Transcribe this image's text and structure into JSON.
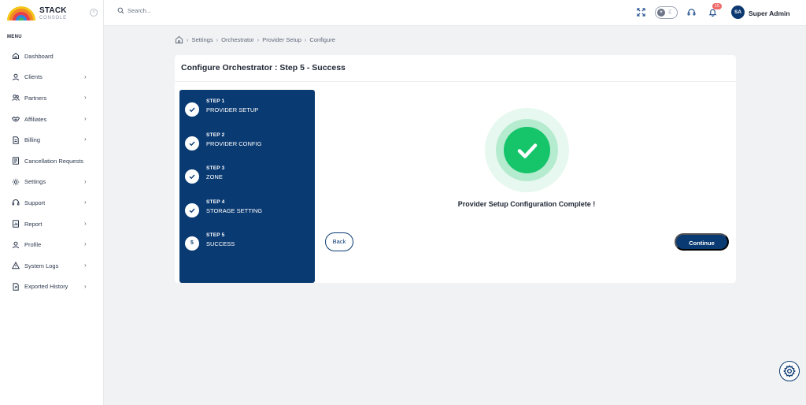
{
  "brand": {
    "name": "STACK",
    "subtitle": "CONSOLE"
  },
  "sidebar": {
    "menu_title": "MENU",
    "items": [
      {
        "label": "Dashboard",
        "icon": "home-icon",
        "has_children": false
      },
      {
        "label": "Clients",
        "icon": "user-icon",
        "has_children": true
      },
      {
        "label": "Partners",
        "icon": "users-icon",
        "has_children": true
      },
      {
        "label": "Affiliates",
        "icon": "handshake-icon",
        "has_children": true
      },
      {
        "label": "Billing",
        "icon": "billing-icon",
        "has_children": true
      },
      {
        "label": "Cancellation Requests",
        "icon": "document-icon",
        "has_children": false
      },
      {
        "label": "Settings",
        "icon": "gear-icon",
        "has_children": true
      },
      {
        "label": "Support",
        "icon": "headset-icon",
        "has_children": true
      },
      {
        "label": "Report",
        "icon": "report-icon",
        "has_children": true
      },
      {
        "label": "Profile",
        "icon": "profile-icon",
        "has_children": true
      },
      {
        "label": "System Logs",
        "icon": "warning-icon",
        "has_children": true
      },
      {
        "label": "Exported History",
        "icon": "export-icon",
        "has_children": true
      }
    ]
  },
  "topbar": {
    "search_placeholder": "Search...",
    "notification_count": "15",
    "user_initials": "SA",
    "user_name": "Super Admin"
  },
  "breadcrumb": [
    "Settings",
    "Orchestrator",
    "Provider Setup",
    "Configure"
  ],
  "page": {
    "title": "Configure Orchestrator : Step 5 - Success",
    "steps": [
      {
        "number": "STEP 1",
        "name": "PROVIDER SETUP",
        "status": "complete",
        "badge": ""
      },
      {
        "number": "STEP 2",
        "name": "PROVIDER CONFIG",
        "status": "complete",
        "badge": ""
      },
      {
        "number": "STEP 3",
        "name": "ZONE",
        "status": "complete",
        "badge": ""
      },
      {
        "number": "STEP 4",
        "name": "STORAGE SETTING",
        "status": "complete",
        "badge": ""
      },
      {
        "number": "STEP 5",
        "name": "SUCCESS",
        "status": "current",
        "badge": "5"
      }
    ],
    "success_message": "Provider Setup Configuration Complete !",
    "back_label": "Back",
    "continue_label": "Continue"
  },
  "colors": {
    "primary": "#0a3a72",
    "success": "#16c46a",
    "background": "#f1f2f4"
  }
}
